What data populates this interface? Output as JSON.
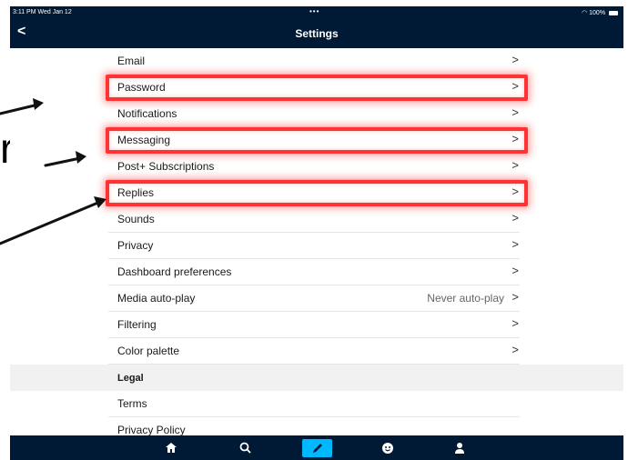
{
  "status_bar": {
    "time": "3:11 PM  Wed Jan 12",
    "dots": "•••",
    "battery": "100%"
  },
  "nav": {
    "back_icon": "chevron-left-icon",
    "back_glyph": "<",
    "title": "Settings"
  },
  "overlay_text": "rd",
  "settings_rows": [
    {
      "label": "Email",
      "chevron": ">"
    },
    {
      "label": "Password",
      "chevron": ">",
      "highlighted": true
    },
    {
      "label": "Notifications",
      "chevron": ">"
    },
    {
      "label": "Messaging",
      "chevron": ">",
      "highlighted": true
    },
    {
      "label": "Post+ Subscriptions",
      "chevron": ">"
    },
    {
      "label": "Replies",
      "chevron": ">",
      "highlighted": true
    },
    {
      "label": "Sounds",
      "chevron": ">"
    },
    {
      "label": "Privacy",
      "chevron": ">"
    },
    {
      "label": "Dashboard preferences",
      "chevron": ">"
    },
    {
      "label": "Media auto-play",
      "value": "Never auto-play",
      "chevron": ">"
    },
    {
      "label": "Filtering",
      "chevron": ">"
    },
    {
      "label": "Color palette",
      "chevron": ">"
    }
  ],
  "legal": {
    "header": "Legal",
    "items": [
      {
        "label": "Terms"
      },
      {
        "label": "Privacy Policy"
      }
    ]
  },
  "tab_bar": {
    "tabs": [
      {
        "name": "home-icon"
      },
      {
        "name": "search-icon"
      },
      {
        "name": "compose-pencil-icon",
        "active": true
      },
      {
        "name": "activity-smiley-icon"
      },
      {
        "name": "account-person-icon"
      }
    ]
  },
  "colors": {
    "nav_bg": "#001935",
    "accent": "#00b8ff",
    "highlight": "#ff3333"
  }
}
